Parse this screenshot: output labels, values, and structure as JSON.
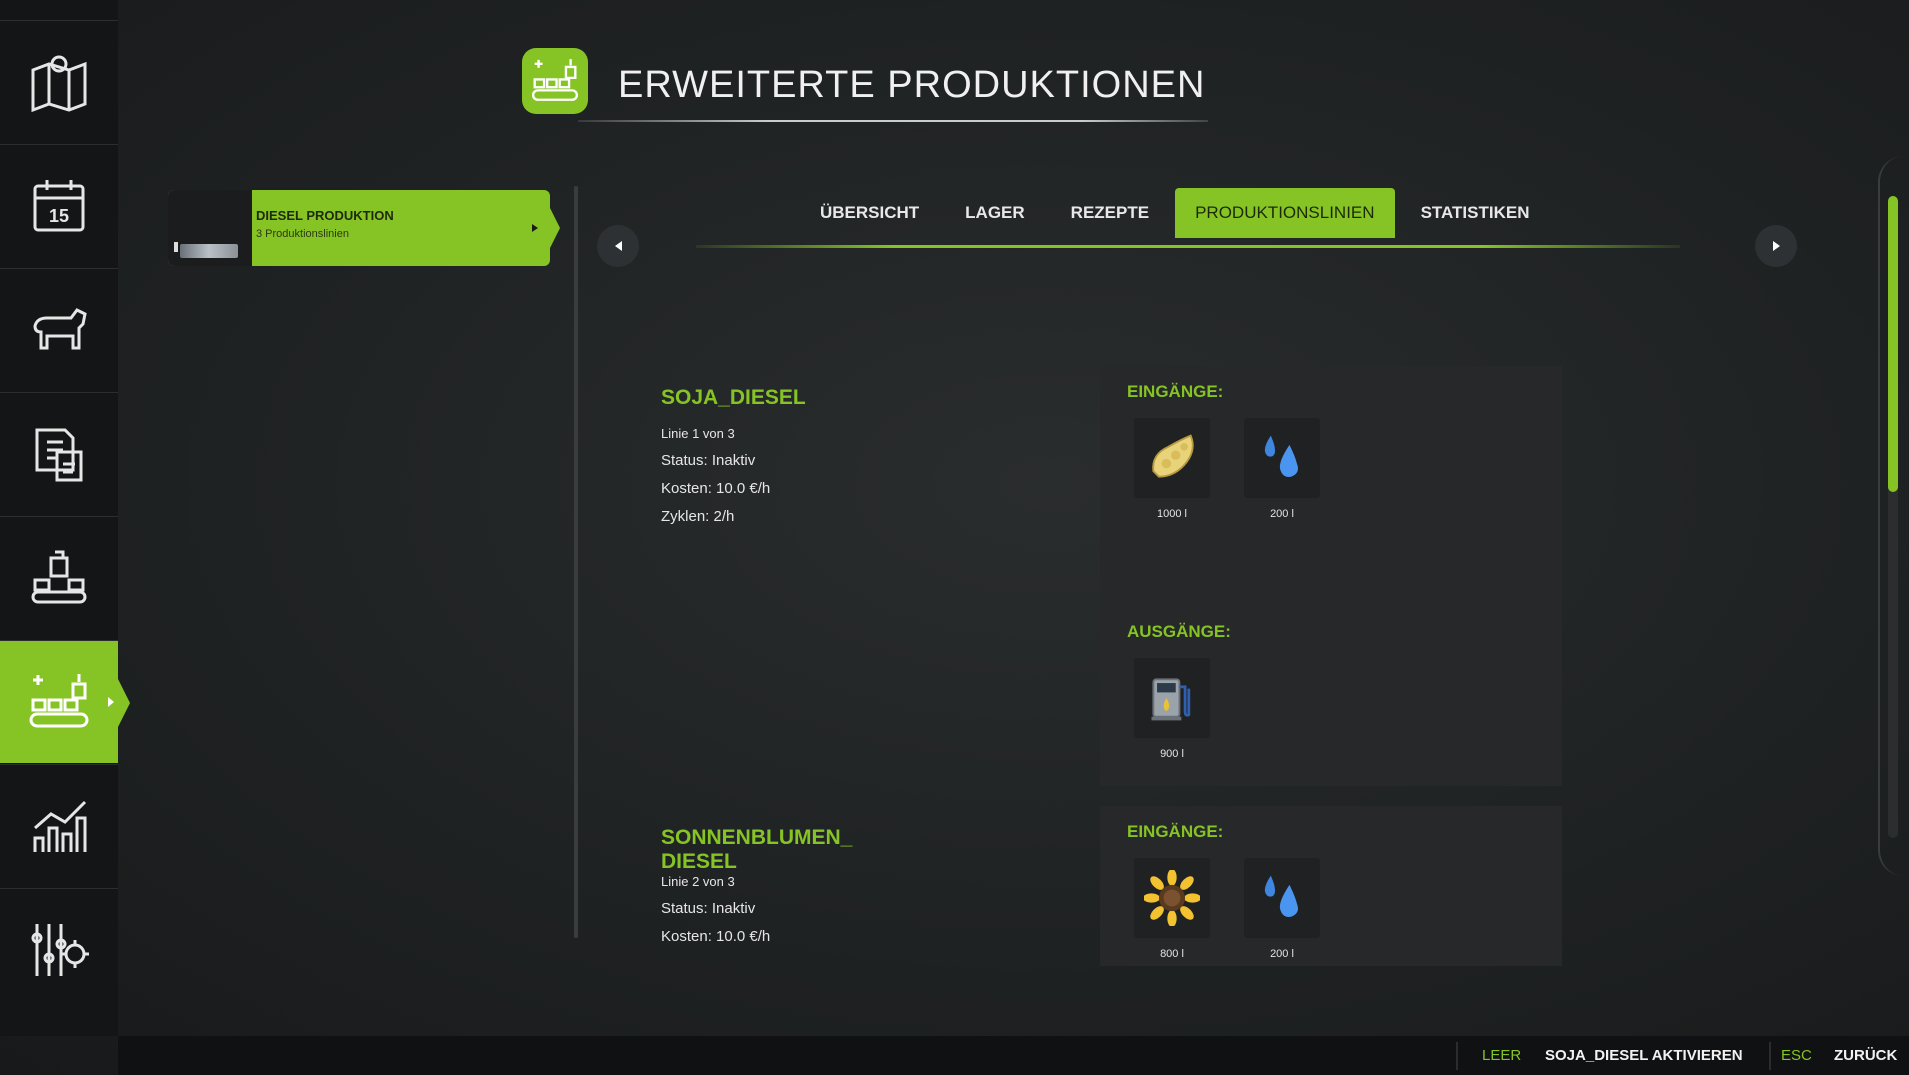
{
  "header": {
    "title": "ERWEITERTE PRODUKTIONEN"
  },
  "sidebar": {
    "items": [
      {
        "icon": "map-icon"
      },
      {
        "icon": "calendar-icon",
        "badge": "15"
      },
      {
        "icon": "animals-icon"
      },
      {
        "icon": "contracts-icon"
      },
      {
        "icon": "production-icon"
      },
      {
        "icon": "extended-production-icon",
        "active": true
      },
      {
        "icon": "statistics-icon"
      },
      {
        "icon": "settings-icon"
      }
    ]
  },
  "production_list": {
    "items": [
      {
        "name": "DIESEL PRODUKTION",
        "subtitle": "3 Produktionslinien"
      }
    ]
  },
  "tabs": [
    {
      "label": "ÜBERSICHT"
    },
    {
      "label": "LAGER"
    },
    {
      "label": "REZEPTE"
    },
    {
      "label": "PRODUKTIONSLINIEN",
      "active": true
    },
    {
      "label": "STATISTIKEN"
    }
  ],
  "lines": [
    {
      "name": "SOJA_DIESEL",
      "count": "Linie 1 von 3",
      "status": "Status: Inaktiv",
      "cost": "Kosten: 10.0 €/h",
      "cycles": "Zyklen: 2/h",
      "inputs_title": "EINGÄNGE:",
      "inputs": [
        {
          "icon": "soybean-icon",
          "amount": "1000 l"
        },
        {
          "icon": "water-icon",
          "amount": "200 l"
        }
      ],
      "outputs_title": "AUSGÄNGE:",
      "outputs": [
        {
          "icon": "diesel-pump-icon",
          "amount": "900 l"
        }
      ]
    },
    {
      "name_line1": "SONNENBLUMEN_",
      "name_line2": "DIESEL",
      "count": "Linie 2 von 3",
      "status": "Status: Inaktiv",
      "cost": "Kosten: 10.0 €/h",
      "inputs_title": "EINGÄNGE:",
      "inputs": [
        {
          "icon": "sunflower-icon",
          "amount": "800 l"
        },
        {
          "icon": "water-icon",
          "amount": "200 l"
        }
      ]
    }
  ],
  "footer": {
    "hints": [
      {
        "key": "LEER",
        "label": "SOJA_DIESEL AKTIVIEREN"
      },
      {
        "key": "ESC",
        "label": "ZURÜCK"
      }
    ]
  },
  "colors": {
    "accent": "#86c425",
    "background": "#1f2223",
    "sidebar": "#141516"
  }
}
